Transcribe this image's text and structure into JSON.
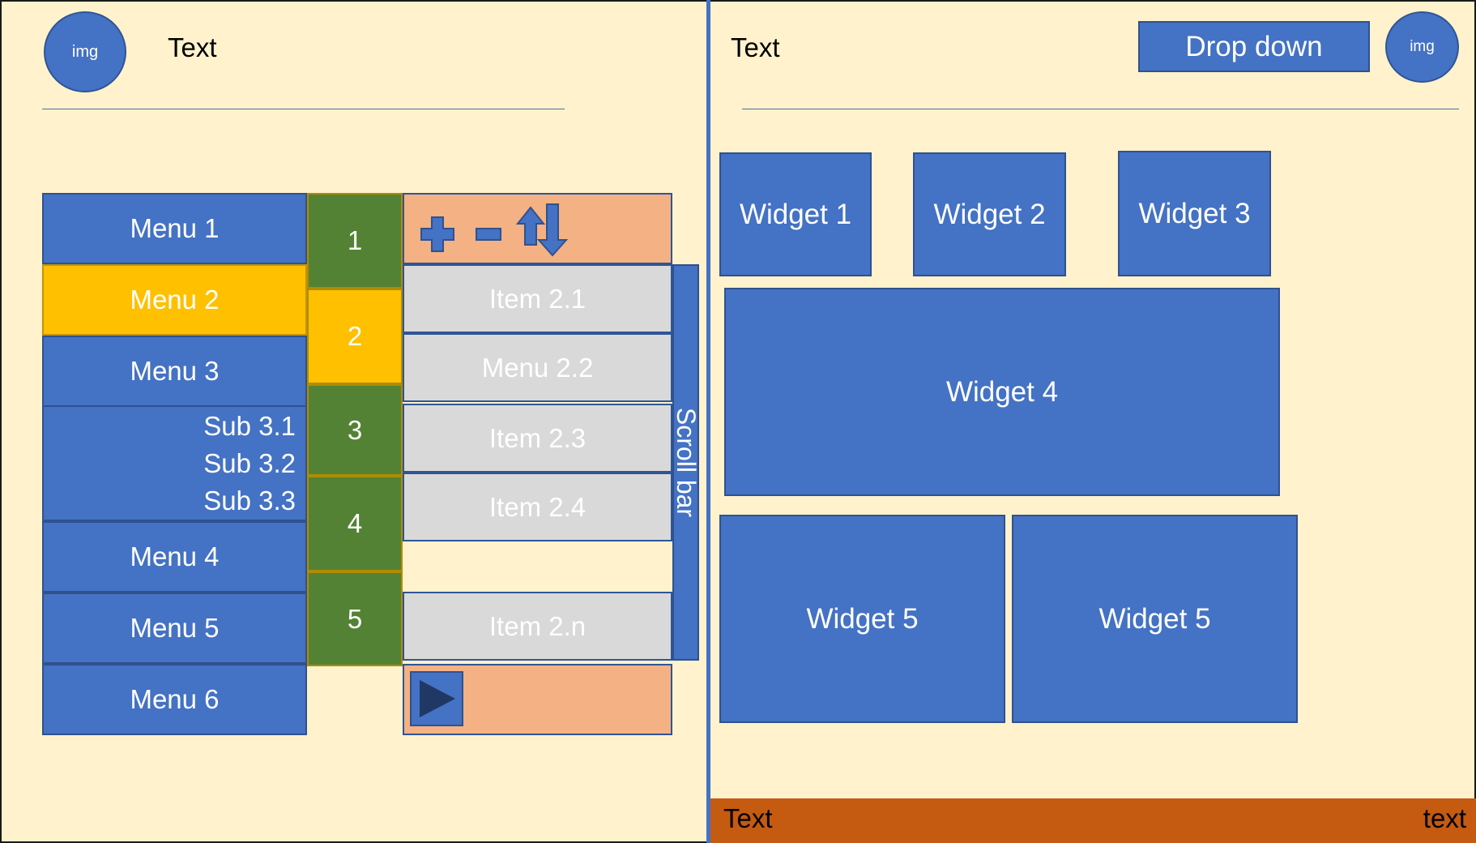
{
  "left_panel": {
    "avatar_label": "img",
    "title": "Text",
    "menu": [
      {
        "label": "Menu 1"
      },
      {
        "label": "Menu 2"
      },
      {
        "label": "Menu 3"
      },
      {
        "label": "Menu 4"
      },
      {
        "label": "Menu 5"
      },
      {
        "label": "Menu 6"
      }
    ],
    "submenu": [
      "Sub 3.1",
      "Sub 3.2",
      "Sub 3.3"
    ],
    "numbers": [
      "1",
      "2",
      "3",
      "4",
      "5"
    ],
    "toolbar_icons": [
      "plus-icon",
      "minus-icon",
      "arrow-up-icon",
      "arrow-down-icon"
    ],
    "items": [
      "Item 2.1",
      "Menu 2.2",
      "Item 2.3",
      "Item 2.4",
      "Item 2.n"
    ],
    "scrollbar_label": "Scroll bar",
    "play_icon": "play-icon"
  },
  "right_panel": {
    "title": "Text",
    "dropdown_label": "Drop down",
    "avatar_label": "img",
    "widgets": [
      "Widget 1",
      "Widget 2",
      "Widget 3",
      "Widget 4",
      "Widget 5",
      "Widget 5"
    ]
  },
  "status_bar": {
    "left_text": "Text",
    "right_text": "text"
  },
  "colors": {
    "background": "#fff2cc",
    "primary": "#4472c4",
    "active": "#ffc000",
    "number_bg": "#548235",
    "toolbar_bg": "#f4b183",
    "item_bg": "#d9d9d9",
    "status_bar": "#c55a11"
  }
}
